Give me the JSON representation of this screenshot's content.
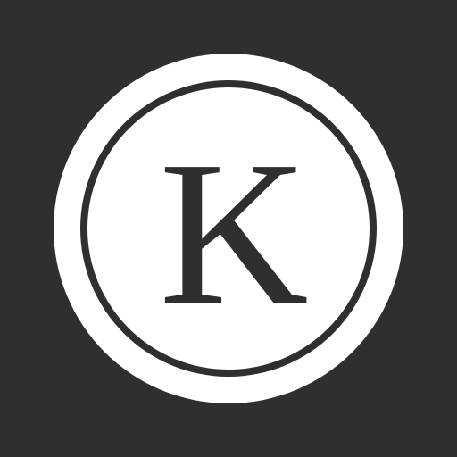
{
  "app_icon": {
    "letter": "K",
    "background_color": "#2f2f2f",
    "ring_color": "#ffffff",
    "letter_color": "#2f2f2f"
  }
}
